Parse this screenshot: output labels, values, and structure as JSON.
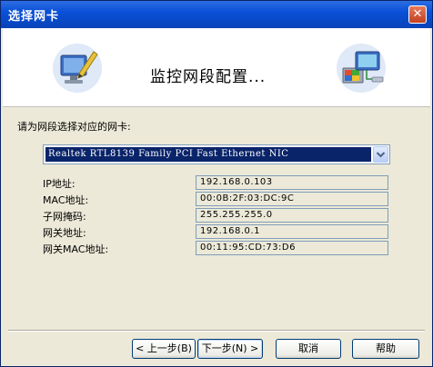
{
  "window": {
    "title": "选择网卡",
    "close_glyph": "✕"
  },
  "header": {
    "title": "监控网段配置..."
  },
  "icons": {
    "left": "monitor-pencil-icon",
    "right": "network-computer-icon",
    "dropdown": "chevron-down-icon"
  },
  "form": {
    "prompt": "请为网段选择对应的网卡:",
    "adapter_selected": "Realtek RTL8139 Family PCI Fast Ethernet NIC",
    "fields": [
      {
        "label": "IP地址:",
        "value": "192.168.0.103"
      },
      {
        "label": "MAC地址:",
        "value": "00:0B:2F:03:DC:9C"
      },
      {
        "label": "子网掩码:",
        "value": "255.255.255.0"
      },
      {
        "label": "网关地址:",
        "value": "192.168.0.1"
      },
      {
        "label": "网关MAC地址:",
        "value": "00:11:95:CD:73:D6"
      }
    ]
  },
  "buttons": {
    "back": "< 上一步(B)",
    "next": "下一步(N) >",
    "cancel": "取消",
    "help": "帮助"
  },
  "colors": {
    "title_bar": "#0a50d8",
    "selection": "#0a246a",
    "dialog_bg": "#ece9d8"
  }
}
